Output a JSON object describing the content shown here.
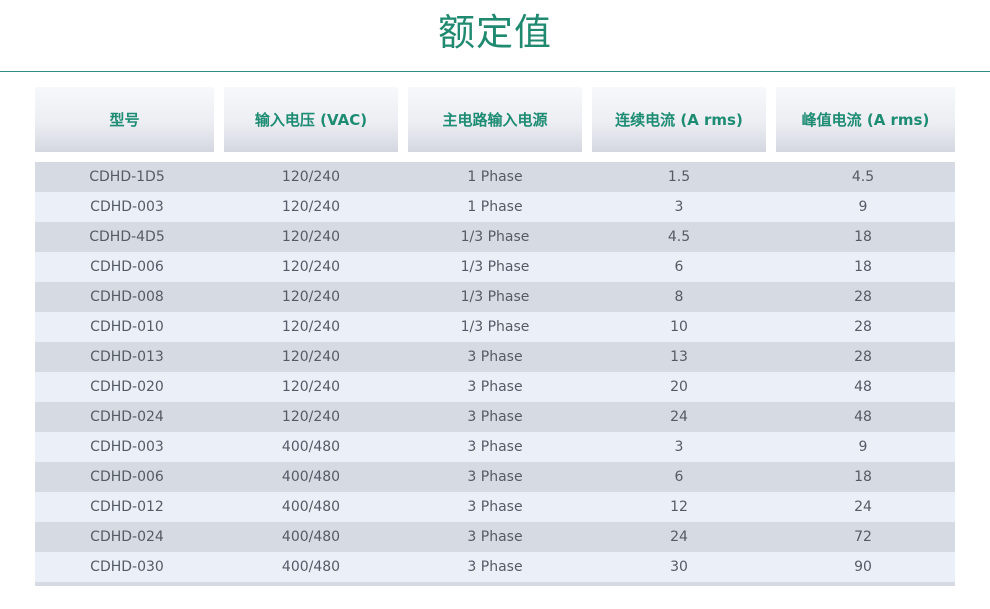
{
  "page": {
    "title": "额定值"
  },
  "table": {
    "headers": [
      "型号",
      "输入电压 (VAC)",
      "主电路输入电源",
      "连续电流 (A rms)",
      "峰值电流 (A rms)"
    ],
    "rows": [
      [
        "CDHD-1D5",
        "120/240",
        "1 Phase",
        "1.5",
        "4.5"
      ],
      [
        "CDHD-003",
        "120/240",
        "1 Phase",
        "3",
        "9"
      ],
      [
        "CDHD-4D5",
        "120/240",
        "1/3 Phase",
        "4.5",
        "18"
      ],
      [
        "CDHD-006",
        "120/240",
        "1/3 Phase",
        "6",
        "18"
      ],
      [
        "CDHD-008",
        "120/240",
        "1/3 Phase",
        "8",
        "28"
      ],
      [
        "CDHD-010",
        "120/240",
        "1/3 Phase",
        "10",
        "28"
      ],
      [
        "CDHD-013",
        "120/240",
        "3 Phase",
        "13",
        "28"
      ],
      [
        "CDHD-020",
        "120/240",
        "3 Phase",
        "20",
        "48"
      ],
      [
        "CDHD-024",
        "120/240",
        "3 Phase",
        "24",
        "48"
      ],
      [
        "CDHD-003",
        "400/480",
        "3 Phase",
        "3",
        "9"
      ],
      [
        "CDHD-006",
        "400/480",
        "3 Phase",
        "6",
        "18"
      ],
      [
        "CDHD-012",
        "400/480",
        "3 Phase",
        "12",
        "24"
      ],
      [
        "CDHD-024",
        "400/480",
        "3 Phase",
        "24",
        "72"
      ],
      [
        "CDHD-030",
        "400/480",
        "3 Phase",
        "30",
        "90"
      ]
    ]
  },
  "colors": {
    "accent": "#1f8a70",
    "row_dark": "#d6dae2",
    "row_light": "#ebeff8",
    "text": "#555b66"
  }
}
